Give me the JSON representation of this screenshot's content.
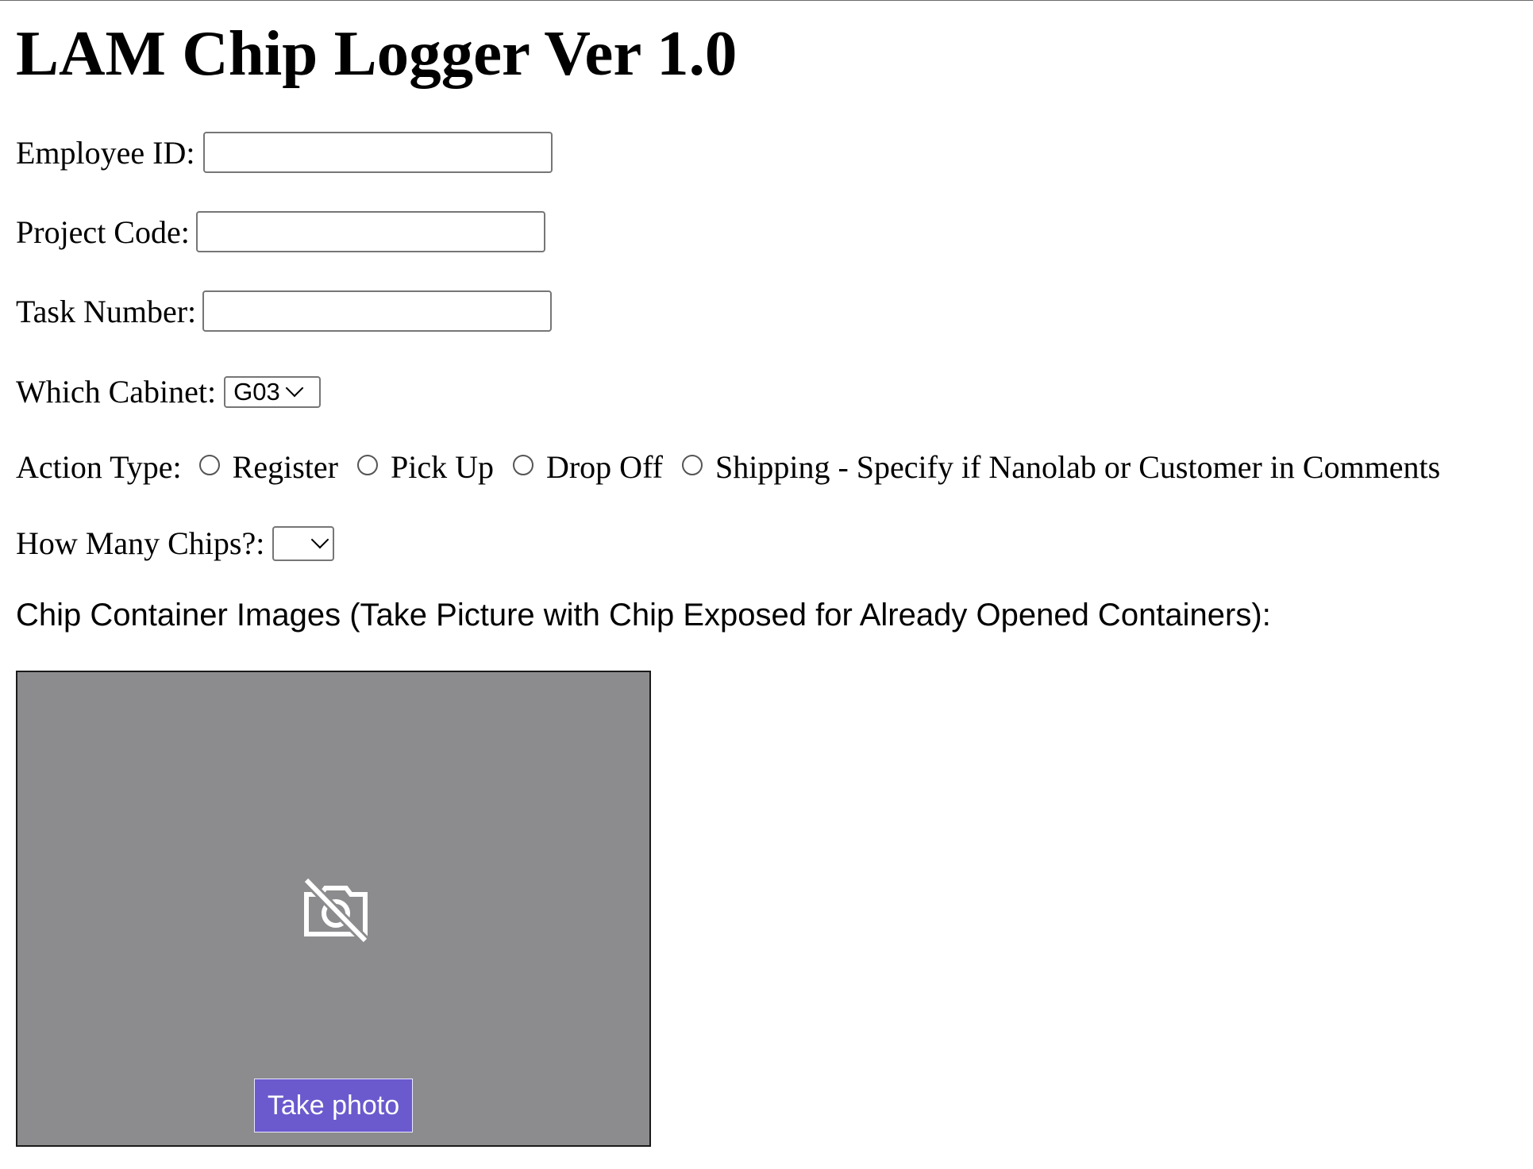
{
  "page": {
    "title": "LAM Chip Logger Ver 1.0"
  },
  "form": {
    "employee_id": {
      "label": "Employee ID:",
      "value": ""
    },
    "project_code": {
      "label": "Project Code:",
      "value": ""
    },
    "task_number": {
      "label": "Task Number:",
      "value": ""
    },
    "cabinet": {
      "label": "Which Cabinet:",
      "selected": "G03"
    },
    "action_type": {
      "label": "Action Type:",
      "options": [
        {
          "label": "Register",
          "checked": false
        },
        {
          "label": "Pick Up",
          "checked": false
        },
        {
          "label": "Drop Off",
          "checked": false
        },
        {
          "label": "Shipping - Specify if Nanolab or Customer in Comments",
          "checked": false
        }
      ]
    },
    "chip_count": {
      "label": "How Many Chips?:",
      "selected": ""
    }
  },
  "images": {
    "heading": "Chip Container Images (Take Picture with Chip Exposed for Already Opened Containers):",
    "camera_icon": "camera-off-icon",
    "take_photo_label": "Take photo"
  },
  "colors": {
    "camera_bg": "#8c8c8e",
    "button_bg": "#6a5acd",
    "button_text": "#ffffff"
  }
}
